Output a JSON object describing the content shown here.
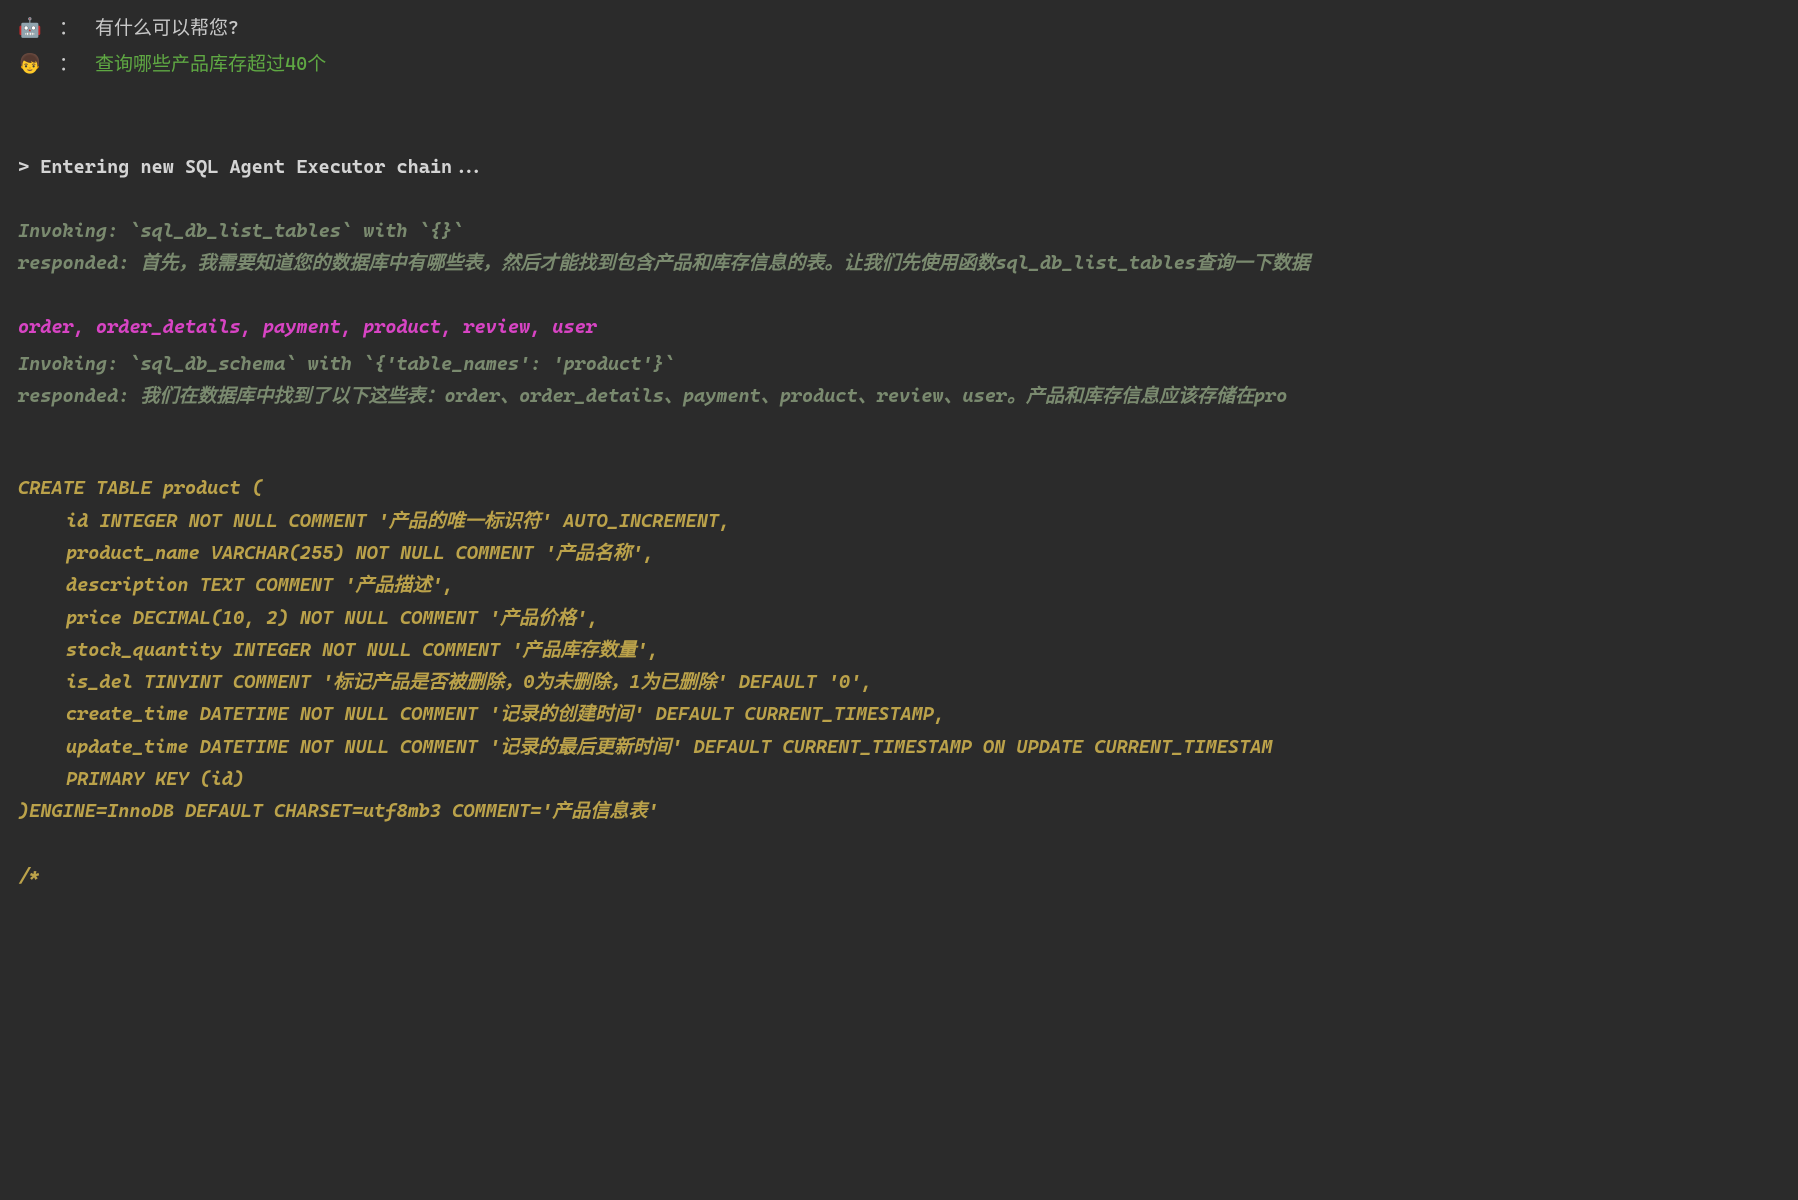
{
  "chat": {
    "bot_emoji": "🤖",
    "user_emoji": "👦",
    "separator": "：",
    "bot_message": "有什么可以帮您?",
    "user_message": "查询哪些产品库存超过40个"
  },
  "output": {
    "entering": "> Entering new SQL Agent Executor chain...",
    "invoke1_label": "Invoking:",
    "invoke1_call": " `sql_db_list_tables` with `{}`",
    "responded1_label": "responded:",
    "responded1_text": " 首先，我需要知道您的数据库中有哪些表，然后才能找到包含产品和库存信息的表。让我们先使用函数sql_db_list_tables查询一下数据",
    "tables": "order, order_details, payment, product, review, user",
    "invoke2_label": "Invoking:",
    "invoke2_call": " `sql_db_schema` with `{'table_names': 'product'}`",
    "responded2_label": "responded:",
    "responded2_text": " 我们在数据库中找到了以下这些表：order、order_details、payment、product、review、user。产品和库存信息应该存储在pro"
  },
  "schema": {
    "l1": "CREATE TABLE product (",
    "l2": "id INTEGER NOT NULL COMMENT '产品的唯一标识符' AUTO_INCREMENT, ",
    "l3": "product_name VARCHAR(255) NOT NULL COMMENT '产品名称', ",
    "l4": "description TEXT COMMENT '产品描述', ",
    "l5": "price DECIMAL(10, 2) NOT NULL COMMENT '产品价格', ",
    "l6": "stock_quantity INTEGER NOT NULL COMMENT '产品库存数量', ",
    "l7": "is_del TINYINT COMMENT '标记产品是否被删除，0为未删除，1为已删除' DEFAULT '0', ",
    "l8": "create_time DATETIME NOT NULL COMMENT '记录的创建时间' DEFAULT CURRENT_TIMESTAMP, ",
    "l9": "update_time DATETIME NOT NULL COMMENT '记录的最后更新时间' DEFAULT CURRENT_TIMESTAMP ON UPDATE CURRENT_TIMESTAM",
    "l10": "PRIMARY KEY (id)",
    "l11": ")ENGINE=InnoDB DEFAULT CHARSET=utf8mb3 COMMENT='产品信息表'",
    "l12": "/*"
  }
}
